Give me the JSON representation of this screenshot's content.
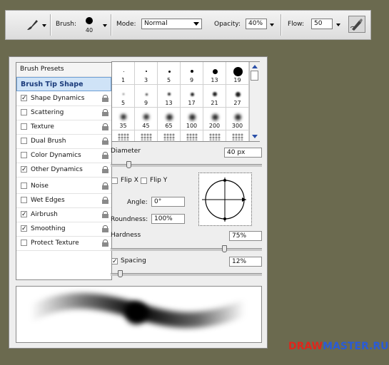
{
  "toolbar": {
    "brush_label": "Brush:",
    "brush_size": "40",
    "mode_label": "Mode:",
    "mode_value": "Normal",
    "opacity_label": "Opacity:",
    "opacity_value": "40%",
    "flow_label": "Flow:",
    "flow_value": "50"
  },
  "sidebar": {
    "items": [
      {
        "label": "Brush Presets",
        "checkbox": null,
        "lock": false
      },
      {
        "label": "Brush Tip Shape",
        "checkbox": null,
        "lock": false,
        "selected": true
      },
      {
        "label": "Shape Dynamics",
        "checkbox": true,
        "lock": true
      },
      {
        "label": "Scattering",
        "checkbox": false,
        "lock": true
      },
      {
        "label": "Texture",
        "checkbox": false,
        "lock": true
      },
      {
        "label": "Dual Brush",
        "checkbox": false,
        "lock": true
      },
      {
        "label": "Color Dynamics",
        "checkbox": false,
        "lock": true
      },
      {
        "label": "Other Dynamics",
        "checkbox": true,
        "lock": true
      },
      {
        "label": "Noise",
        "checkbox": false,
        "lock": true
      },
      {
        "label": "Wet Edges",
        "checkbox": false,
        "lock": true
      },
      {
        "label": "Airbrush",
        "checkbox": true,
        "lock": true
      },
      {
        "label": "Smoothing",
        "checkbox": true,
        "lock": true
      },
      {
        "label": "Protect Texture",
        "checkbox": false,
        "lock": true
      }
    ]
  },
  "brush_grid": {
    "sizes": [
      "1",
      "3",
      "5",
      "9",
      "13",
      "19",
      "5",
      "9",
      "13",
      "17",
      "21",
      "27",
      "35",
      "45",
      "65",
      "100",
      "200",
      "300"
    ]
  },
  "tip": {
    "diameter_label": "Diameter",
    "diameter_value": "40 px",
    "diameter_level": 0.12,
    "flipx_label": "Flip X",
    "flipy_label": "Flip Y",
    "angle_label": "Angle:",
    "angle_value": "0°",
    "roundness_label": "Roundness:",
    "roundness_value": "100%",
    "hardness_label": "Hardness",
    "hardness_value": "75%",
    "hardness_level": 0.75,
    "spacing_label": "Spacing",
    "spacing_value": "12%",
    "spacing_level": 0.06,
    "spacing_checked": true
  },
  "watermark": {
    "part1": "DRAW",
    "part2": "MASTER.RU",
    "color1": "#e0251b",
    "color2": "#2a5bd7"
  }
}
